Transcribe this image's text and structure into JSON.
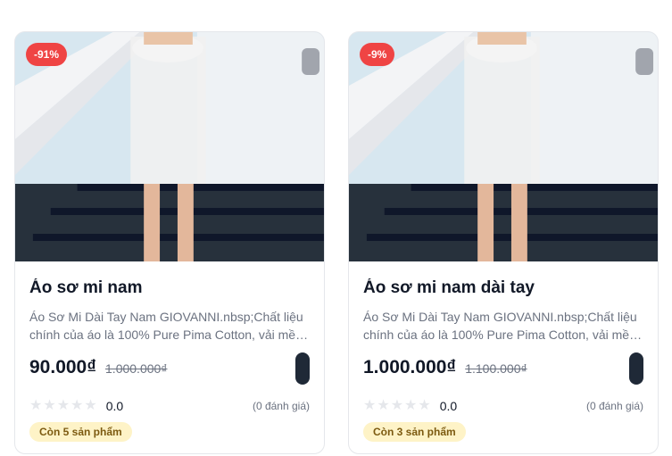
{
  "products": [
    {
      "discount": "-91%",
      "title": "Áo sơ mi nam",
      "description": "Áo Sơ Mi Dài Tay Nam GIOVANNI.nbsp;Chất liệu chính của áo là 100% Pure Pima Cotton, vải mềm mại",
      "price": "90.000₫",
      "old_price": "1.000.000₫",
      "rating_value": "0.0",
      "review_count": "(0 đánh giá)",
      "stock": "Còn 5 sản phẩm",
      "stars_filled": 0
    },
    {
      "discount": "-9%",
      "title": "Áo sơ mi nam dài tay",
      "description": "Áo Sơ Mi Dài Tay Nam GIOVANNI.nbsp;Chất liệu chính của áo là 100% Pure Pima Cotton, vải mềm mại",
      "price": "1.000.000₫",
      "old_price": "1.100.000₫",
      "rating_value": "0.0",
      "review_count": "(0 đánh giá)",
      "stock": "Còn 3 sản phẩm",
      "stars_filled": 0
    }
  ],
  "colors": {
    "discount_badge": "#ef4444",
    "stock_badge_bg": "#fef3c7",
    "cart_button": "#1f2937",
    "star_empty": "#e5e7eb"
  },
  "icons": {
    "star": "star-icon",
    "cart": "cart-icon"
  }
}
